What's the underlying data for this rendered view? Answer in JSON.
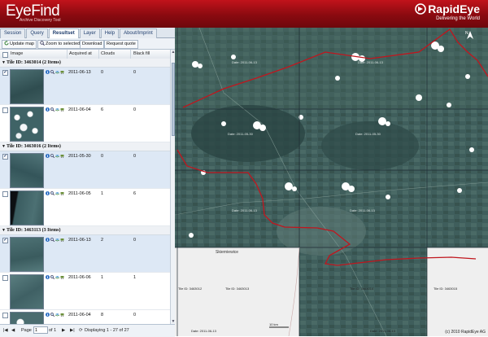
{
  "header": {
    "title": "EyeFind",
    "subtitle": "Archive Discovery Tool",
    "brand": "RapidEye",
    "tagline": "Delivering the World"
  },
  "tabs": [
    "Session",
    "Query",
    "Resultset",
    "Layer",
    "Help",
    "About/Imprint"
  ],
  "active_tab": "Resultset",
  "toolbar": {
    "update_map": "Update map",
    "zoom_selected": "Zoom to selected",
    "download": "Download",
    "request_quote": "Request quote"
  },
  "columns": {
    "image": "Image",
    "acquired": "Acquired at",
    "clouds": "Clouds",
    "black_fill": "Black fill"
  },
  "groups": [
    {
      "label": "Tile ID: 3463014 (2 Items)",
      "rows": [
        {
          "date": "2011-06-13",
          "clouds": "0",
          "black": "0",
          "checked": true
        },
        {
          "date": "2011-06-04",
          "clouds": "6",
          "black": "0",
          "checked": false
        }
      ]
    },
    {
      "label": "Tile ID: 3463016 (2 Items)",
      "rows": [
        {
          "date": "2011-05-30",
          "clouds": "0",
          "black": "0",
          "checked": true
        },
        {
          "date": "2011-06-05",
          "clouds": "1",
          "black": "6",
          "checked": false
        }
      ]
    },
    {
      "label": "Tile ID: 3463113 (3 Items)",
      "rows": [
        {
          "date": "2011-06-13",
          "clouds": "2",
          "black": "0",
          "checked": true
        },
        {
          "date": "2011-06-06",
          "clouds": "1",
          "black": "1",
          "checked": false
        },
        {
          "date": "2011-06-04",
          "clouds": "8",
          "black": "0",
          "checked": false
        }
      ]
    }
  ],
  "pager": {
    "page_label": "Page",
    "page_value": "1",
    "of_label": "of 1",
    "display": "Displaying 1 - 27 of 27"
  },
  "map": {
    "north": "N",
    "place": "Skierniewice",
    "scale": "10 km",
    "copyright": "(c) 2010 RapidEye AG",
    "tile_labels": [
      "Tile ID: 3463012",
      "Tile ID: 3463013",
      "Tile ID: 3463014",
      "Tile ID: 3463015"
    ],
    "date_labels": [
      "Date: 2011-06-13",
      "Date: 2011-06-13",
      "Date: 2011-05-30",
      "Date: 2011-05-30",
      "Date: 2011-06-13",
      "Date: 2011-06-13",
      "Date: 2011-06-13",
      "Date: 2011-06-13"
    ]
  },
  "colors": {
    "brand_red": "#b0101a",
    "tab_blue": "#1f3d6d",
    "border_red": "#c0161e"
  }
}
